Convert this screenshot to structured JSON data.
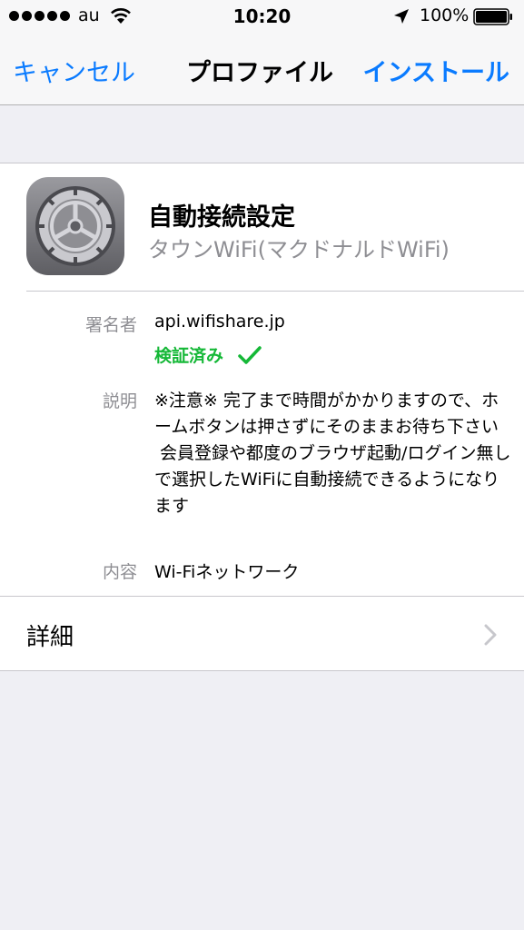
{
  "status_bar": {
    "carrier": "au",
    "time": "10:20",
    "battery": "100%",
    "icons": [
      "signal-dots",
      "wifi-icon",
      "location-icon",
      "battery-icon"
    ]
  },
  "nav": {
    "cancel": "キャンセル",
    "title": "プロファイル",
    "install": "インストール"
  },
  "profile": {
    "name": "自動接続設定",
    "organization": "タウンWiFi(マクドナルドWiFi)",
    "icon": "settings-gear-icon",
    "signer_label": "署名者",
    "signer": "api.wifishare.jp",
    "verified": "検証済み",
    "description_label": "説明",
    "description": "※注意※ 完了まで時間がかかりますので、ホームボタンは押さずにそのままお待ち下さい\n 会員登録や都度のブラウザ起動/ログイン無しで選択したWiFiに自動接続できるようになります",
    "contents_label": "内容",
    "contents": "Wi-Fiネットワーク",
    "details": "詳細"
  },
  "colors": {
    "accent": "#0a7bff",
    "verified": "#15b837",
    "secondary_text": "#8e8e93",
    "background": "#efeff4"
  }
}
